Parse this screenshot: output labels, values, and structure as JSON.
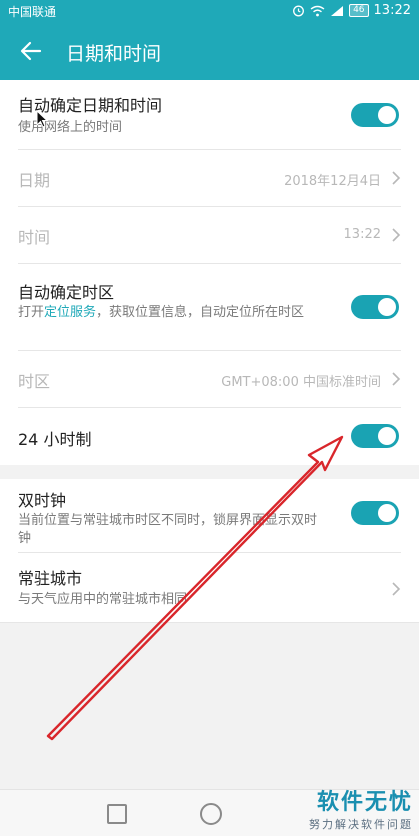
{
  "status_bar": {
    "carrier": "中国联通",
    "battery": "46",
    "time": "13:22",
    "icons": [
      "alarm-icon",
      "wifi-icon",
      "signal-icon",
      "battery-icon"
    ]
  },
  "app_bar": {
    "title": "日期和时间",
    "back_icon": "arrow-left-icon"
  },
  "settings": {
    "auto_datetime": {
      "title": "自动确定日期和时间",
      "subtitle": "使用网络上的时间",
      "enabled": true
    },
    "date": {
      "title": "日期",
      "value": "2018年12月4日"
    },
    "time": {
      "title": "时间",
      "value": "13:22"
    },
    "auto_timezone": {
      "title": "自动确定时区",
      "subtitle_prefix": "打开",
      "subtitle_link": "定位服务",
      "subtitle_suffix": "，获取位置信息，自动定位所在时区",
      "enabled": true
    },
    "timezone": {
      "title": "时区",
      "value": "GMT+08:00 中国标准时间"
    },
    "hour24": {
      "title": "24 小时制",
      "enabled": true
    },
    "dual_clock": {
      "title": "双时钟",
      "subtitle": "当前位置与常驻城市时区不同时，锁屏界面显示双时钟",
      "enabled": true
    },
    "home_city": {
      "title": "常驻城市",
      "subtitle": "与天气应用中的常驻城市相同"
    }
  },
  "watermark": {
    "main": "软件无忧",
    "sub": "努力解决软件问题"
  },
  "colors": {
    "accent": "#1fa9b8",
    "toggle_on": "#1aa3b3",
    "arrow": "#d9262b"
  }
}
